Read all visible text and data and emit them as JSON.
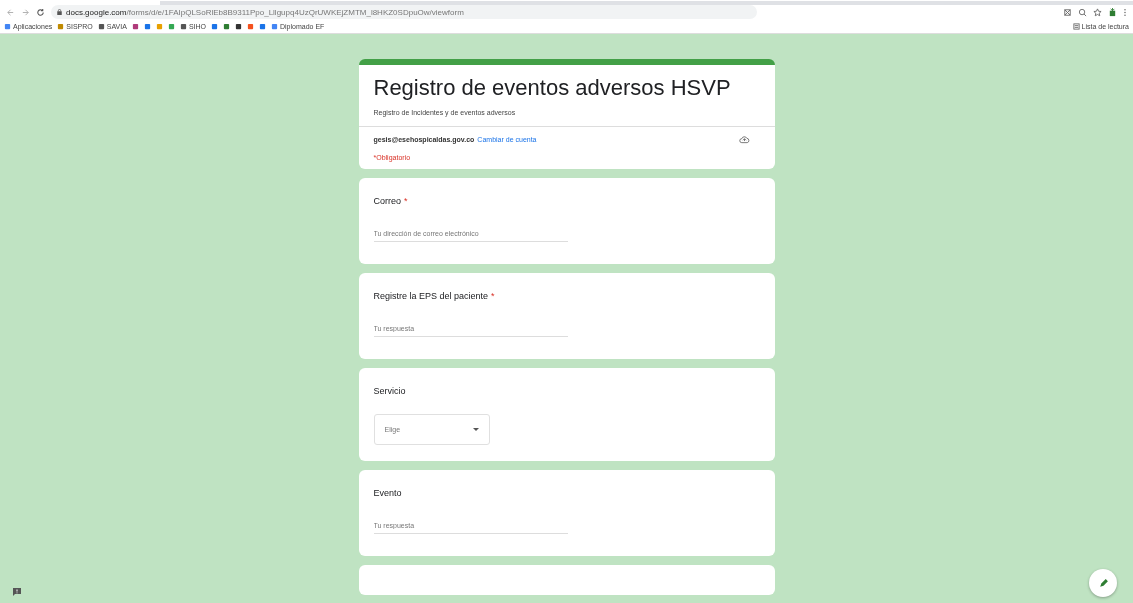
{
  "browser": {
    "url_host": "docs.google.com",
    "url_path": "/forms/d/e/1FAIpQLSoRlEb8B9311Ppo_Lllgupq4UzQrUWKEjZMTM_l8HKZ0SDpuOw/viewform",
    "bookmarks": [
      {
        "kind": "labeled",
        "label": "Aplicaciones"
      },
      {
        "kind": "labeled",
        "label": "SISPRO"
      },
      {
        "kind": "labeled",
        "label": "SAVIA"
      },
      {
        "kind": "icon"
      },
      {
        "kind": "icon"
      },
      {
        "kind": "icon"
      },
      {
        "kind": "icon"
      },
      {
        "kind": "labeled",
        "label": "SIHO"
      },
      {
        "kind": "icon"
      },
      {
        "kind": "icon"
      },
      {
        "kind": "icon"
      },
      {
        "kind": "icon"
      },
      {
        "kind": "icon"
      },
      {
        "kind": "labeled",
        "label": "Diplomado EF"
      }
    ],
    "reading_list": "Lista de lectura"
  },
  "form": {
    "title": "Registro de eventos adversos HSVP",
    "description": "Registro de Incidentes y de eventos adversos",
    "account": "gesis@esehospicaldas.gov.co",
    "switch_account": "Cambiar de cuenta",
    "required_note": "*Obligatorio",
    "required_mark": "*",
    "questions": [
      {
        "kind": "text",
        "label": "Correo",
        "required": true,
        "placeholder": "Tu dirección de correo electrónico"
      },
      {
        "kind": "text",
        "label": "Registre la EPS del paciente",
        "required": true,
        "placeholder": "Tu respuesta"
      },
      {
        "kind": "select",
        "label": "Servicio",
        "required": false,
        "placeholder": "Elige"
      },
      {
        "kind": "text",
        "label": "Evento",
        "required": false,
        "placeholder": "Tu respuesta"
      }
    ]
  }
}
